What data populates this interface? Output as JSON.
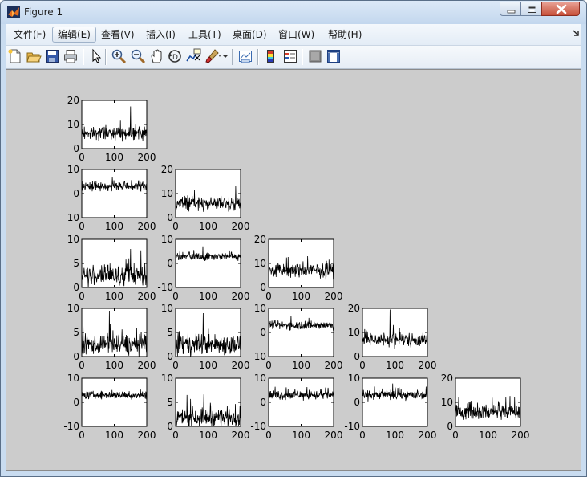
{
  "window": {
    "title": "Figure 1",
    "icon": "matlab-logo-icon"
  },
  "menu": {
    "items": [
      {
        "label": "文件(F)"
      },
      {
        "label": "编辑(E)",
        "active": true
      },
      {
        "label": "查看(V)"
      },
      {
        "label": "插入(I)"
      },
      {
        "label": "工具(T)"
      },
      {
        "label": "桌面(D)"
      },
      {
        "label": "窗口(W)"
      },
      {
        "label": "帮助(H)"
      }
    ]
  },
  "toolbar": {
    "buttons": [
      "new-figure-icon",
      "open-file-icon",
      "save-figure-icon",
      "print-figure-icon",
      "edit-plot-arrow-icon",
      "zoom-in-icon",
      "zoom-out-icon",
      "pan-hand-icon",
      "rotate-3d-icon",
      "data-cursor-icon",
      "brush-icon",
      "link-plot-icon",
      "insert-colorbar-icon",
      "insert-legend-icon",
      "hide-plot-tools-icon",
      "show-plot-tools-icon"
    ]
  },
  "figure": {
    "background_color": "#cccccc",
    "subplots": [
      {
        "name": "r1c1",
        "row": 1,
        "col": 1,
        "ylim": [
          0,
          20
        ],
        "yticks": [
          "0",
          "10",
          "20"
        ],
        "xticks": [
          "0",
          "100",
          "200"
        ],
        "baseline": 6.5,
        "noise": 1.6,
        "spikes": [
          [
            150,
            17.5
          ]
        ]
      },
      {
        "name": "r2c1",
        "row": 2,
        "col": 1,
        "ylim": [
          -10,
          10
        ],
        "yticks": [
          "-10",
          "0",
          "10"
        ],
        "xticks": [
          "0",
          "100",
          "200"
        ],
        "baseline": 3,
        "noise": 1.2,
        "spikes": []
      },
      {
        "name": "r2c2",
        "row": 2,
        "col": 2,
        "ylim": [
          0,
          20
        ],
        "yticks": [
          "0",
          "10",
          "20"
        ],
        "xticks": [
          "0",
          "100",
          "200"
        ],
        "baseline": 6,
        "noise": 1.7,
        "spikes": [
          [
            185,
            13
          ]
        ]
      },
      {
        "name": "r3c1",
        "row": 3,
        "col": 1,
        "ylim": [
          0,
          10
        ],
        "yticks": [
          "0",
          "5",
          "10"
        ],
        "xticks": [
          "0",
          "100",
          "200"
        ],
        "baseline": 2.5,
        "noise": 1.3,
        "spikes": [
          [
            150,
            8
          ]
        ]
      },
      {
        "name": "r3c2",
        "row": 3,
        "col": 2,
        "ylim": [
          -10,
          10
        ],
        "yticks": [
          "-10",
          "0",
          "10"
        ],
        "xticks": [
          "0",
          "100",
          "200"
        ],
        "baseline": 3,
        "noise": 1.0,
        "spikes": []
      },
      {
        "name": "r3c3",
        "row": 3,
        "col": 3,
        "ylim": [
          0,
          20
        ],
        "yticks": [
          "0",
          "10",
          "20"
        ],
        "xticks": [
          "0",
          "100",
          "200"
        ],
        "baseline": 7,
        "noise": 1.8,
        "spikes": [
          [
            120,
            13
          ]
        ]
      },
      {
        "name": "r4c1",
        "row": 4,
        "col": 1,
        "ylim": [
          0,
          10
        ],
        "yticks": [
          "0",
          "5",
          "10"
        ],
        "xticks": [
          "0",
          "100",
          "200"
        ],
        "baseline": 2.5,
        "noise": 1.3,
        "spikes": [
          [
            85,
            9.5
          ]
        ]
      },
      {
        "name": "r4c2",
        "row": 4,
        "col": 2,
        "ylim": [
          0,
          10
        ],
        "yticks": [
          "0",
          "5",
          "10"
        ],
        "xticks": [
          "0",
          "100",
          "200"
        ],
        "baseline": 2.5,
        "noise": 1.3,
        "spikes": [
          [
            85,
            9
          ]
        ]
      },
      {
        "name": "r4c3",
        "row": 4,
        "col": 3,
        "ylim": [
          -10,
          10
        ],
        "yticks": [
          "-10",
          "0",
          "10"
        ],
        "xticks": [
          "0",
          "100",
          "200"
        ],
        "baseline": 3,
        "noise": 1.1,
        "spikes": []
      },
      {
        "name": "r4c4",
        "row": 4,
        "col": 4,
        "ylim": [
          0,
          20
        ],
        "yticks": [
          "0",
          "10",
          "20"
        ],
        "xticks": [
          "0",
          "100",
          "200"
        ],
        "baseline": 7,
        "noise": 1.8,
        "spikes": [
          [
            85,
            19.5
          ]
        ]
      },
      {
        "name": "r5c1",
        "row": 5,
        "col": 1,
        "ylim": [
          -10,
          10
        ],
        "yticks": [
          "-10",
          "0",
          "10"
        ],
        "xticks": [
          "0",
          "100",
          "200"
        ],
        "baseline": 3,
        "noise": 1.0,
        "spikes": []
      },
      {
        "name": "r5c2",
        "row": 5,
        "col": 2,
        "ylim": [
          0,
          10
        ],
        "yticks": [
          "0",
          "5",
          "10"
        ],
        "xticks": [
          "0",
          "100",
          "200"
        ],
        "baseline": 2,
        "noise": 1.2,
        "spikes": []
      },
      {
        "name": "r5c3",
        "row": 5,
        "col": 3,
        "ylim": [
          -10,
          10
        ],
        "yticks": [
          "-10",
          "0",
          "10"
        ],
        "xticks": [
          "0",
          "100",
          "200"
        ],
        "baseline": 3,
        "noise": 1.2,
        "spikes": []
      },
      {
        "name": "r5c4",
        "row": 5,
        "col": 4,
        "ylim": [
          -10,
          10
        ],
        "yticks": [
          "-10",
          "0",
          "10"
        ],
        "xticks": [
          "0",
          "100",
          "200"
        ],
        "baseline": 3,
        "noise": 1.2,
        "spikes": []
      },
      {
        "name": "r5c5",
        "row": 5,
        "col": 5,
        "ylim": [
          0,
          20
        ],
        "yticks": [
          "0",
          "10",
          "20"
        ],
        "xticks": [
          "0",
          "100",
          "200"
        ],
        "baseline": 6,
        "noise": 1.8,
        "spikes": [
          [
            155,
            12
          ]
        ]
      }
    ]
  }
}
